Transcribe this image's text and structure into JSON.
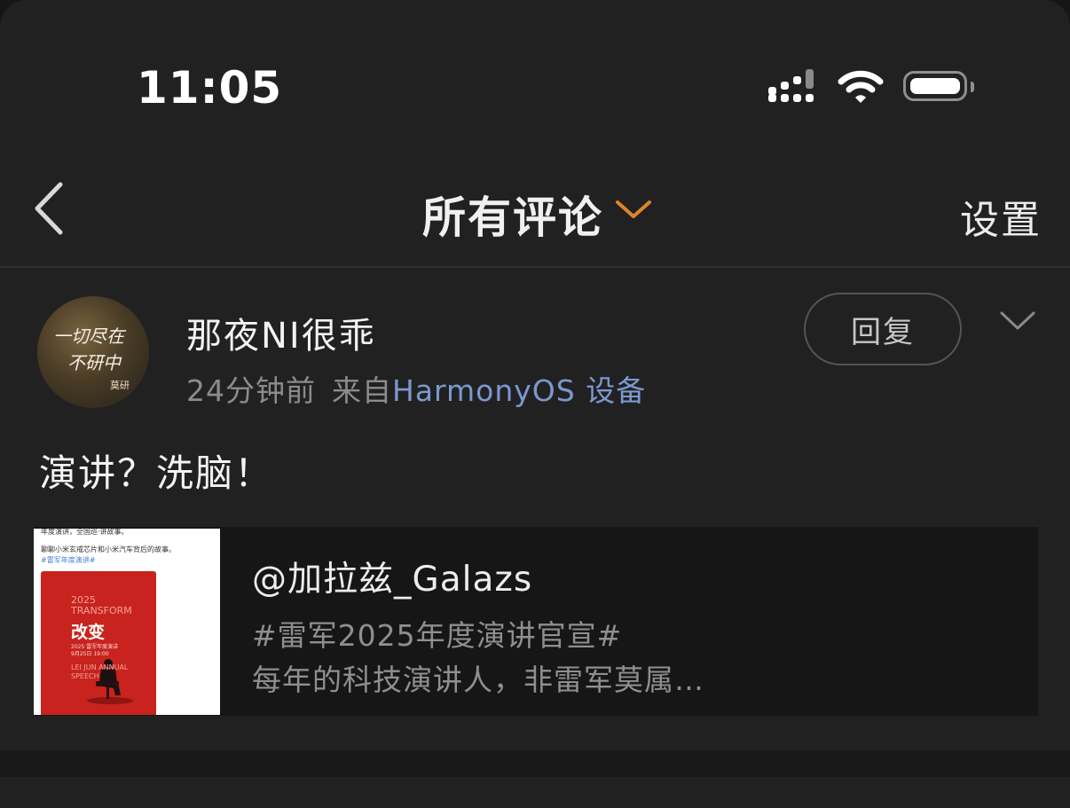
{
  "status_bar": {
    "time": "11:05",
    "battery_level": 1.0
  },
  "nav": {
    "title": "所有评论",
    "settings_label": "设置",
    "chevron_color": "#e0822a"
  },
  "comment": {
    "avatar_text_line1": "一切尽在",
    "avatar_text_line2": "不研中",
    "avatar_text_line3": "莫研",
    "username": "那夜NI很乖",
    "time_ago": "24分钟前",
    "from_label": "来自",
    "device": "HarmonyOS 设备",
    "reply_label": "回复",
    "text": "演讲？洗脑！",
    "link_color": "#7b98cf"
  },
  "quote_card": {
    "thumb": {
      "line0": "年度演讲，全国巡·讲故事。",
      "line1": "聊聊小米玄戒芯片和小米汽车背后的故事。",
      "line2": "#雷军年度演讲#",
      "poster_year": "2025",
      "poster_transform": "TRANSFORM",
      "poster_title": "改变",
      "poster_sub1": "2025 雷军年度演讲",
      "poster_sub2": "9月25日 19:00",
      "poster_en1": "LEI JUN ANNUAL",
      "poster_en2": "SPEECH",
      "poster_color": "#c8231e"
    },
    "author": "@加拉兹_Galazs",
    "hashtag": "#雷军2025年度演讲官宣#",
    "text": "每年的科技演讲人，非雷军莫属…"
  }
}
